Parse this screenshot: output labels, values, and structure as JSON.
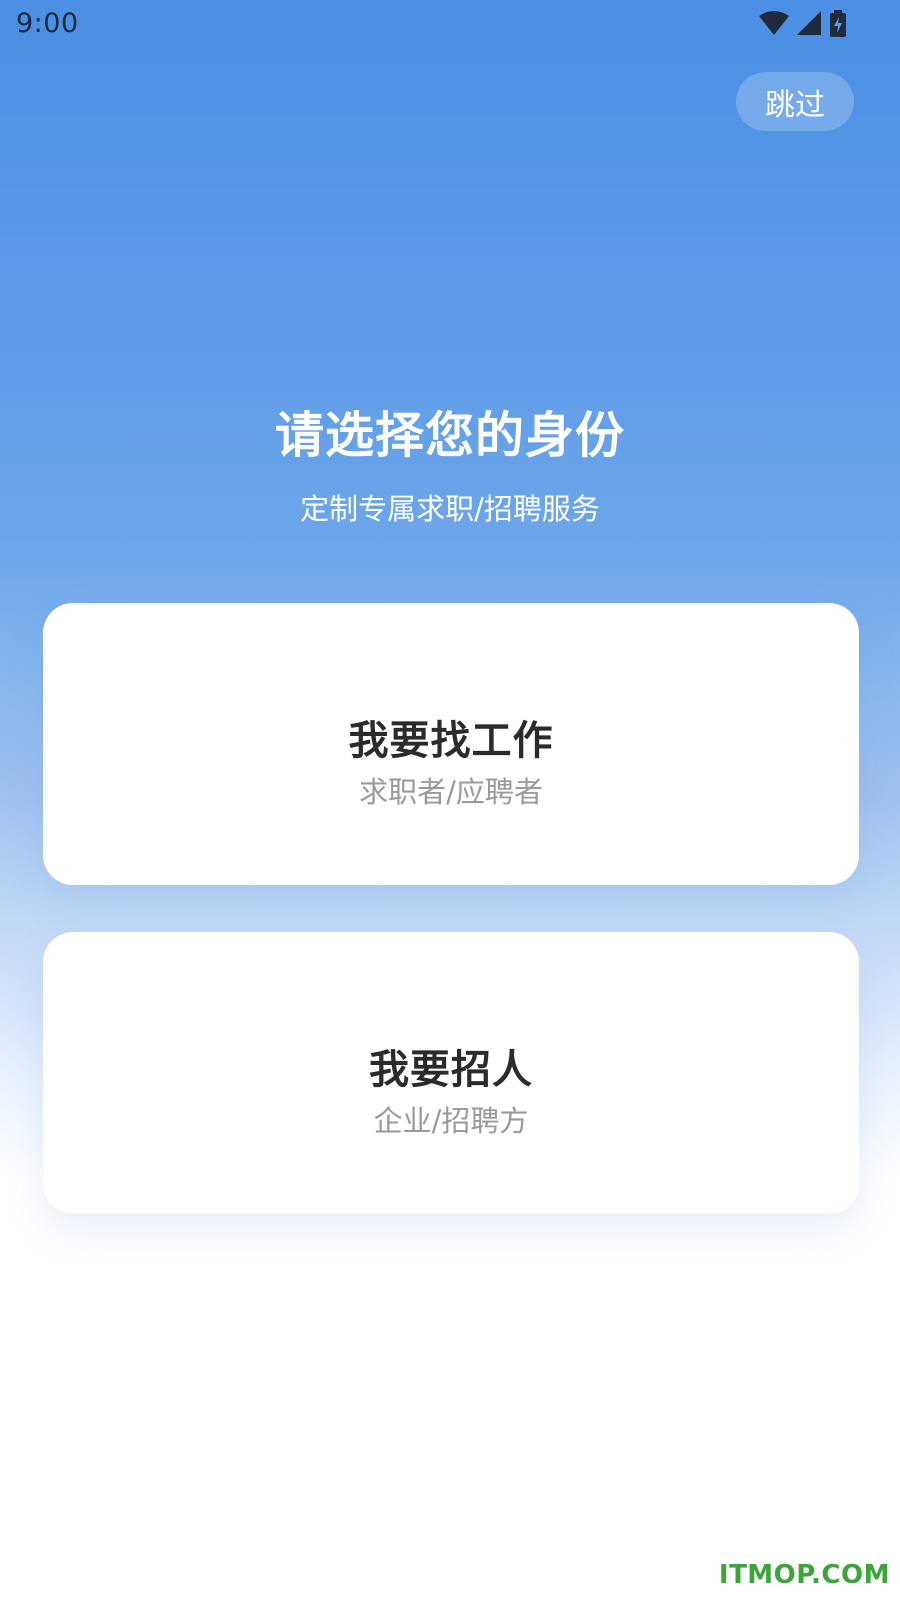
{
  "status_bar": {
    "time": "9:00",
    "icons": [
      "wifi-icon",
      "cellular-signal-icon",
      "battery-charging-icon"
    ]
  },
  "header": {
    "skip_label": "跳过"
  },
  "intro": {
    "title": "请选择您的身份",
    "subtitle": "定制专属求职/招聘服务"
  },
  "roles": [
    {
      "title": "我要找工作",
      "subtitle": "求职者/应聘者"
    },
    {
      "title": "我要招人",
      "subtitle": "企业/招聘方"
    }
  ],
  "watermark": "ITMOP.COM",
  "colors": {
    "gradient_top": "#4a8fe3",
    "gradient_bottom": "#ffffff",
    "card_title": "#2b2b2b",
    "card_subtitle": "#9a9a9a",
    "watermark": "#3aa63a"
  }
}
